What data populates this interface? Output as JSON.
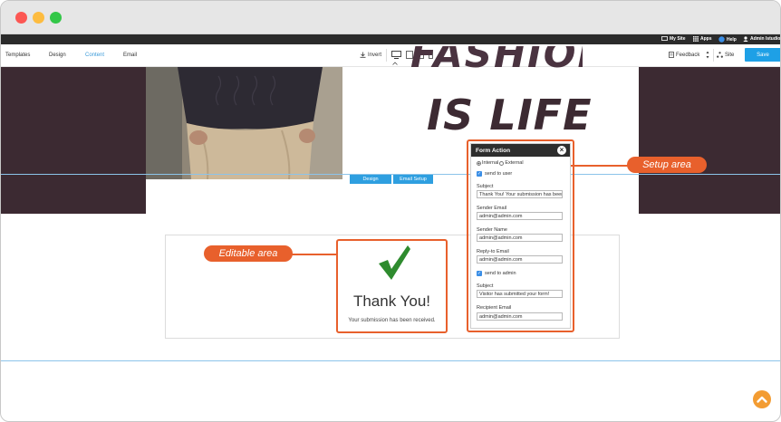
{
  "top_bar": {
    "my_site": "My Site",
    "apps": "Apps",
    "help": "Help",
    "admin": "Admin Istudio"
  },
  "toolbar": {
    "tabs": [
      "Templates",
      "Design",
      "Content",
      "Email"
    ],
    "active_tab": "Content",
    "invert": "Invert",
    "feedback": "Feedback",
    "site": "Site",
    "save": "Save"
  },
  "hero": {
    "fashion": "FASHION",
    "is_life": "IS LIFE"
  },
  "section_buttons": {
    "design": "Design",
    "email_setup": "Email Setup"
  },
  "thank_you": {
    "title": "Thank You!",
    "message": "Your submission has been received."
  },
  "callouts": {
    "editable": "Editable area",
    "setup": "Setup area"
  },
  "form_action": {
    "title": "Form Action",
    "radio_internal": "Internal",
    "radio_external": "External",
    "selected_radio": "Internal",
    "send_to_user": "send to user",
    "subject_label": "Subject",
    "subject_value": "Thank You! Your submission has been",
    "sender_email_label": "Sender Email",
    "sender_email_value": "admin@admin.com",
    "sender_name_label": "Sender Name",
    "sender_name_value": "admin@admin.com",
    "reply_to_label": "Reply-to Email",
    "reply_to_value": "admin@admin.com",
    "send_to_admin": "send to admin",
    "subject2_label": "Subject",
    "subject2_value": "Visitor has submitted your form!",
    "recipient_label": "Recipient Email",
    "recipient_value": "admin@admin.com"
  },
  "colors": {
    "accent": "#e8602c",
    "primary_blue": "#1ea0e6",
    "dark_maroon": "#3c2a32"
  }
}
